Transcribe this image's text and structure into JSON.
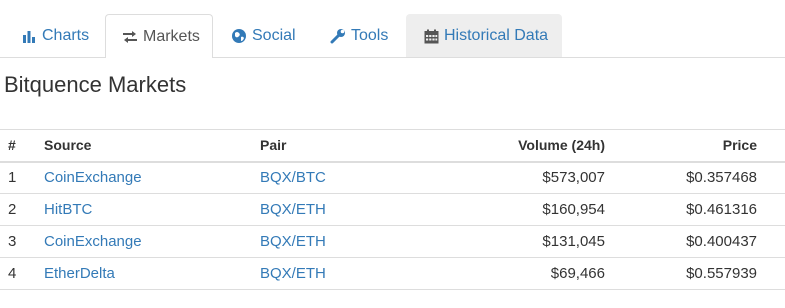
{
  "tabs": [
    {
      "label": "Charts",
      "icon": "bar-chart-icon",
      "active": false
    },
    {
      "label": "Markets",
      "icon": "exchange-arrows-icon",
      "active": true
    },
    {
      "label": "Social",
      "icon": "globe-icon",
      "active": false
    },
    {
      "label": "Tools",
      "icon": "wrench-icon",
      "active": false
    },
    {
      "label": "Historical Data",
      "icon": "calendar-icon",
      "active": false
    }
  ],
  "heading": "Bitquence Markets",
  "table": {
    "headers": {
      "num": "#",
      "source": "Source",
      "pair": "Pair",
      "volume": "Volume (24h)",
      "price": "Price"
    },
    "rows": [
      {
        "num": "1",
        "source": "CoinExchange",
        "pair": "BQX/BTC",
        "volume": "$573,007",
        "price": "$0.357468"
      },
      {
        "num": "2",
        "source": "HitBTC",
        "pair": "BQX/ETH",
        "volume": "$160,954",
        "price": "$0.461316"
      },
      {
        "num": "3",
        "source": "CoinExchange",
        "pair": "BQX/ETH",
        "volume": "$131,045",
        "price": "$0.400437"
      },
      {
        "num": "4",
        "source": "EtherDelta",
        "pair": "BQX/ETH",
        "volume": "$69,466",
        "price": "$0.557939"
      }
    ]
  },
  "colors": {
    "link": "#337ab7",
    "text": "#333333",
    "active_tab_text": "#555555",
    "border": "#dddddd",
    "shaded_tab": "#eeeeee"
  }
}
